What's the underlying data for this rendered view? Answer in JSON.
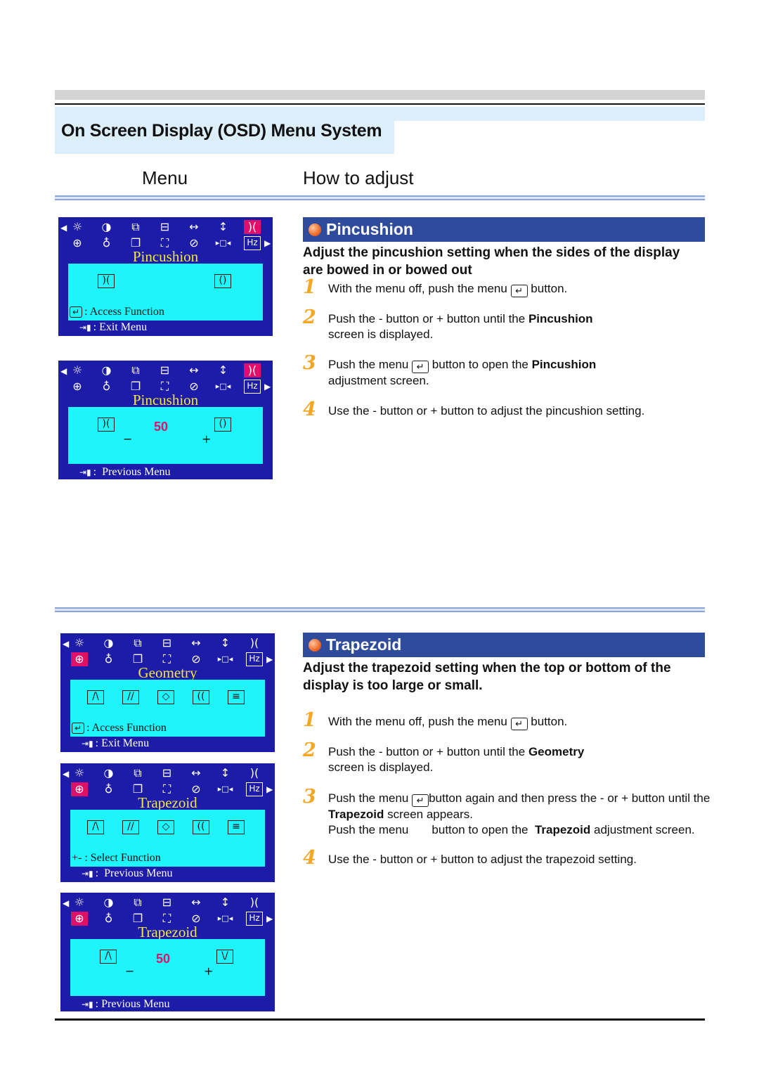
{
  "header": {
    "title": "On Screen Display (OSD) Menu System",
    "col_menu": "Menu",
    "col_how": "How to adjust"
  },
  "colors": {
    "osd_bg": "#1c1ca8",
    "osd_inner": "#1ef5fa",
    "highlight": "#e0106a",
    "osd_title": "#f2e640",
    "section_bar": "#2f4b9c",
    "step_number": "#f5a623"
  },
  "osd_icons": {
    "row1": [
      "brightness-icon",
      "contrast-icon",
      "position-icon",
      "size-icon",
      "h-size-icon",
      "v-size-icon",
      "pincushion-icon"
    ],
    "row2": [
      "geometry-icon",
      "moire-icon",
      "recall-icon",
      "zoom-icon",
      "degauss-icon",
      "input-icon",
      "hz-icon"
    ],
    "hz_label": "Hz"
  },
  "osd_panels": [
    {
      "title": "Pincushion",
      "selected": "pincushion-icon",
      "content_icons": [
        "pincushion-in-icon",
        "pincushion-out-icon"
      ],
      "footer": [
        {
          "icon": "enter-icon",
          "text": ": Access Function",
          "inner": true
        },
        {
          "icon": "exit-icon",
          "text": ": Exit Menu",
          "inner": false
        }
      ]
    },
    {
      "title": "Pincushion",
      "selected": "pincushion-icon",
      "content_icons": [
        "pincushion-in-icon",
        "pincushion-out-icon"
      ],
      "value": "50",
      "minus": "−",
      "plus": "+",
      "footer": [
        {
          "icon": "exit-icon",
          "text": ":  Previous Menu",
          "inner": false
        }
      ]
    },
    {
      "title": "Geometry",
      "selected": "geometry-icon",
      "content_icons": [
        "trapezoid-icon",
        "parallelogram-icon",
        "rotation-icon",
        "pinbalance-icon",
        "linearity-icon"
      ],
      "footer": [
        {
          "icon": "enter-icon",
          "text": ": Access Function",
          "inner": true
        },
        {
          "icon": "exit-icon",
          "text": ": Exit Menu",
          "inner": false
        }
      ]
    },
    {
      "title": "Trapezoid",
      "selected": "geometry-icon",
      "content_icons": [
        "trapezoid-icon",
        "parallelogram-icon",
        "rotation-icon",
        "pinbalance-icon",
        "linearity-icon"
      ],
      "footer": [
        {
          "icon": "plus-minus-icon",
          "text": "+- : Select Function",
          "inner": true
        },
        {
          "icon": "exit-icon",
          "text": ":  Previous Menu",
          "inner": false
        }
      ]
    },
    {
      "title": "Trapezoid",
      "selected": "geometry-icon",
      "content_icons": [
        "trapezoid-icon",
        "trapezoid-inverse-icon"
      ],
      "value": "50",
      "minus": "−",
      "plus": "+",
      "footer": [
        {
          "icon": "exit-icon",
          "text": ": Previous Menu",
          "inner": false
        }
      ]
    }
  ],
  "pincushion": {
    "title": "Pincushion",
    "subtitle": "Adjust the pincushion setting when the sides of the display are bowed in or bowed out",
    "steps": [
      {
        "num": "1",
        "a": "With the menu off, push the menu ",
        "b": " button."
      },
      {
        "num": "2",
        "a": "Push the  - button or  + button until the ",
        "bold": "Pincushion",
        "c": " screen is displayed."
      },
      {
        "num": "3",
        "a": "Push the menu ",
        "b": " button to open the ",
        "bold": "Pincushion",
        "c": " adjustment screen."
      },
      {
        "num": "4",
        "a": "Use the  - button or  + button to adjust the pincushion setting."
      }
    ]
  },
  "trapezoid": {
    "title": "Trapezoid",
    "subtitle": "Adjust the trapezoid setting when the top or bottom of the display is too large or small.",
    "steps": [
      {
        "num": "1",
        "a": "With the menu off, push the menu ",
        "b": " button."
      },
      {
        "num": "2",
        "a": "Push the - button or + button until the ",
        "bold": "Geometry",
        "c": " screen is displayed."
      },
      {
        "num": "3",
        "a": "Push the menu ",
        "b": "button again and then press the - or + button until the ",
        "bold": "Trapezoid",
        "c": "  screen appears.",
        "d": "Push the menu       button to open the  ",
        "bold2": "Trapezoid",
        "e": " adjustment screen."
      },
      {
        "num": "4",
        "a": "Use the  - button or  + button to adjust the trapezoid setting."
      }
    ]
  }
}
